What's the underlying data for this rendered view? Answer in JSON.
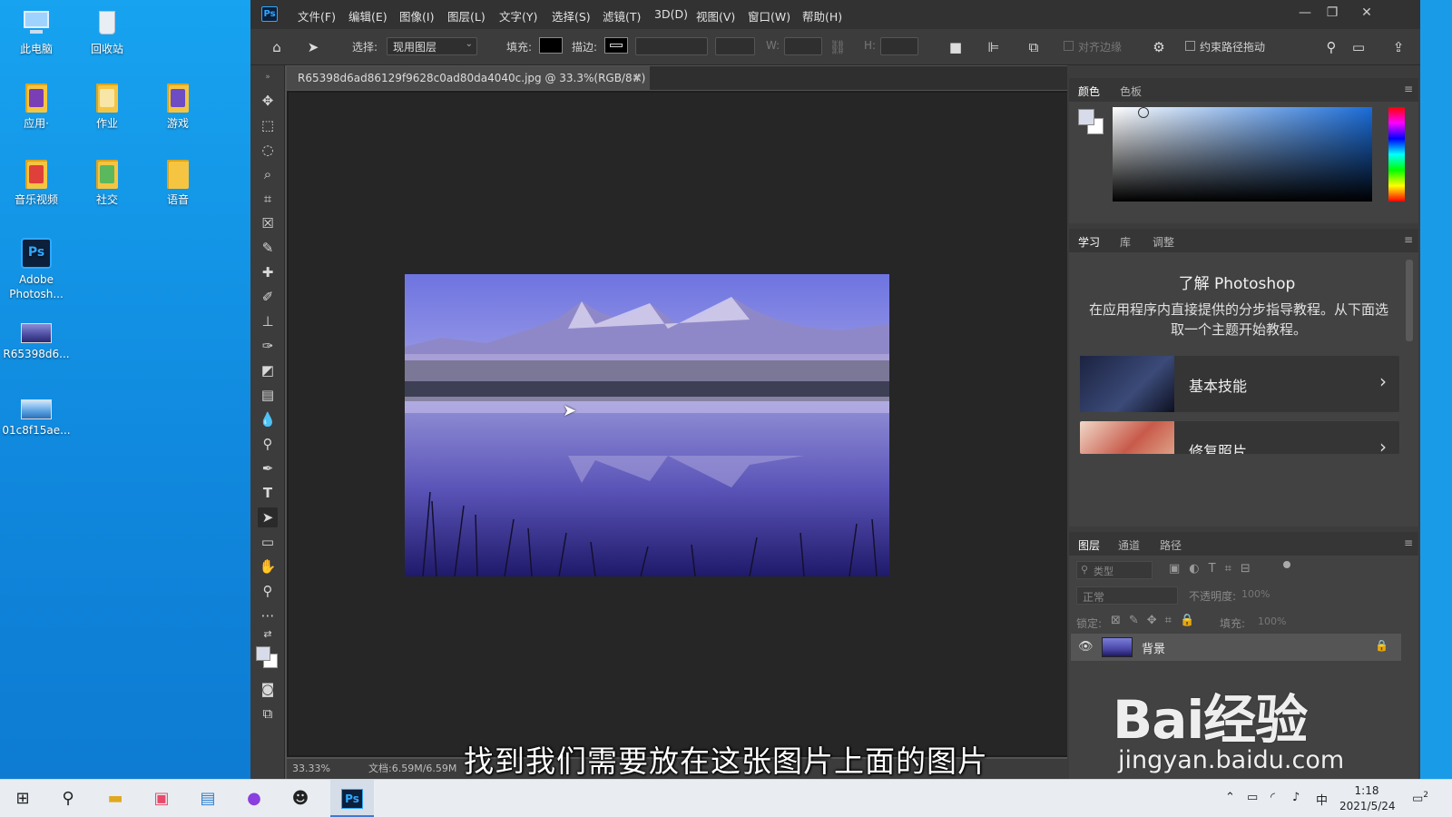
{
  "desktop": {
    "icons": [
      {
        "label": "此电脑",
        "icon": "computer-icon"
      },
      {
        "label": "回收站",
        "icon": "recycle-bin-icon"
      },
      {
        "label": "应用·",
        "icon": "folder-icon"
      },
      {
        "label": "作业",
        "icon": "folder-icon"
      },
      {
        "label": "游戏",
        "icon": "folder-icon"
      },
      {
        "label": "音乐视频",
        "icon": "folder-icon"
      },
      {
        "label": "社交",
        "icon": "folder-icon"
      },
      {
        "label": "语音",
        "icon": "folder-icon"
      },
      {
        "label": "Adobe Photosh...",
        "icon": "photoshop-icon"
      },
      {
        "label": "R65398d6...",
        "icon": "image-file-icon"
      },
      {
        "label": "01c8f15ae...",
        "icon": "image-file-icon"
      }
    ]
  },
  "photoshop": {
    "logo": "Ps",
    "menu": [
      "文件(F)",
      "编辑(E)",
      "图像(I)",
      "图层(L)",
      "文字(Y)",
      "选择(S)",
      "滤镜(T)",
      "3D(D)",
      "视图(V)",
      "窗口(W)",
      "帮助(H)"
    ],
    "options": {
      "select_label": "选择:",
      "select_value": "现用图层",
      "fill_label": "填充:",
      "stroke_label": "描边:",
      "w_label": "W:",
      "h_label": "H:",
      "align_edges": "对齐边缘",
      "constrain_path": "约束路径拖动"
    },
    "document": {
      "tab_title": "R65398d6ad86129f9628c0ad80da4040c.jpg @ 33.3%(RGB/8#)",
      "close": "×",
      "zoom": "33.33%",
      "doc_size": "文档:6.59M/6.59M"
    },
    "color_panel": {
      "tabs": [
        "颜色",
        "色板"
      ]
    },
    "learn_panel": {
      "tabs": [
        "学习",
        "库",
        "调整"
      ],
      "title": "了解 Photoshop",
      "desc": "在应用程序内直接提供的分步指导教程。从下面选取一个主题开始教程。",
      "cards": [
        {
          "label": "基本技能"
        },
        {
          "label": "修复照片"
        }
      ]
    },
    "layers_panel": {
      "tabs": [
        "图层",
        "通道",
        "路径"
      ],
      "filter_placeholder": "类型",
      "blend_mode": "正常",
      "opacity_label": "不透明度:",
      "opacity_value": "100%",
      "lock_label": "锁定:",
      "fill_label": "填充:",
      "fill_value": "100%",
      "layers": [
        {
          "name": "背景",
          "visible": true,
          "locked": true
        }
      ]
    }
  },
  "taskbar": {
    "apps": [
      "start-icon",
      "search-icon",
      "file-explorer-icon",
      "video-app-icon",
      "news-icon",
      "voice-icon",
      "qq-icon",
      "photoshop-icon"
    ],
    "tray": {
      "ime": "中",
      "time": "1:18",
      "date": "2021/5/24",
      "notifications": "2"
    }
  },
  "overlay": {
    "subtitle": "找到我们需要放在这张图片上面的图片",
    "watermark_brand": "Bai经验",
    "watermark_url": "jingyan.baidu.com"
  }
}
